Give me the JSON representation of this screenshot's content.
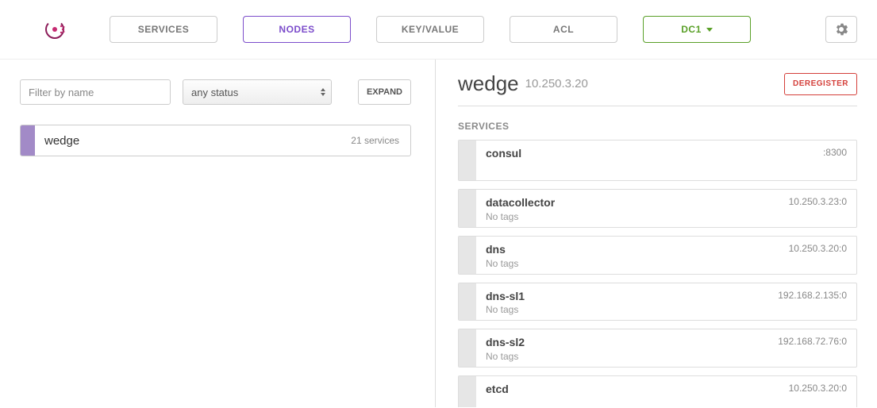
{
  "header": {
    "nav": {
      "services": "SERVICES",
      "nodes": "NODES",
      "kv": "KEY/VALUE",
      "acl": "ACL",
      "datacenter": "DC1"
    }
  },
  "left": {
    "filter_placeholder": "Filter by name",
    "status_filter": "any status",
    "expand_label": "EXPAND",
    "node": {
      "name": "wedge",
      "count": "21 services"
    }
  },
  "detail": {
    "title": "wedge",
    "ip": "10.250.3.20",
    "deregister": "DEREGISTER",
    "section_label": "SERVICES",
    "services": [
      {
        "name": "consul",
        "tags": "",
        "addr": ":8300",
        "tall": true
      },
      {
        "name": "datacollector",
        "tags": "No tags",
        "addr": "10.250.3.23:0",
        "tall": false
      },
      {
        "name": "dns",
        "tags": "No tags",
        "addr": "10.250.3.20:0",
        "tall": false
      },
      {
        "name": "dns-sl1",
        "tags": "No tags",
        "addr": "192.168.2.135:0",
        "tall": false
      },
      {
        "name": "dns-sl2",
        "tags": "No tags",
        "addr": "192.168.72.76:0",
        "tall": false
      },
      {
        "name": "etcd",
        "tags": "",
        "addr": "10.250.3.20:0",
        "tall": false
      }
    ]
  }
}
